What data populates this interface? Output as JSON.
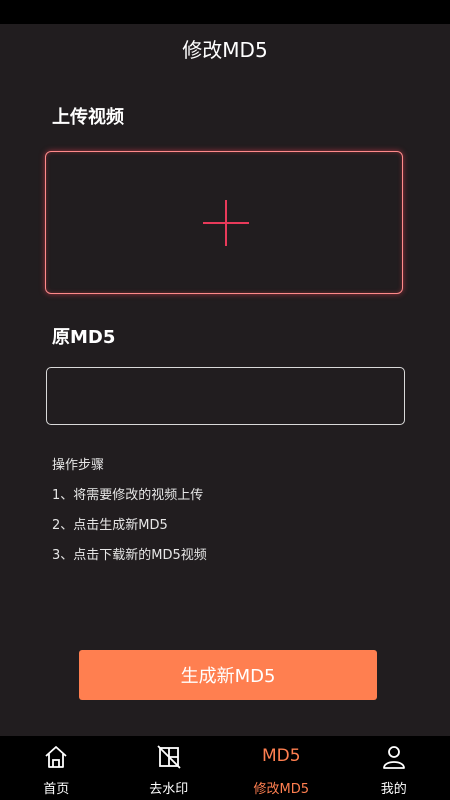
{
  "header": {
    "title": "修改MD5"
  },
  "upload": {
    "label": "上传视频"
  },
  "md5": {
    "label": "原MD5",
    "value": "",
    "placeholder": ""
  },
  "steps": {
    "title": "操作步骤",
    "items": [
      "1、将需要修改的视频上传",
      "2、点击生成新MD5",
      "3、点击下载新的MD5视频"
    ]
  },
  "generate_button": "生成新MD5",
  "tabbar": {
    "active_color": "#ff7f50",
    "tabs": [
      {
        "label": "首页",
        "icon": "home-icon"
      },
      {
        "label": "去水印",
        "icon": "remove-watermark-icon"
      },
      {
        "label": "修改MD5",
        "icon": "md5-icon",
        "glyph": "MD5",
        "active": true
      },
      {
        "label": "我的",
        "icon": "user-icon"
      }
    ]
  }
}
